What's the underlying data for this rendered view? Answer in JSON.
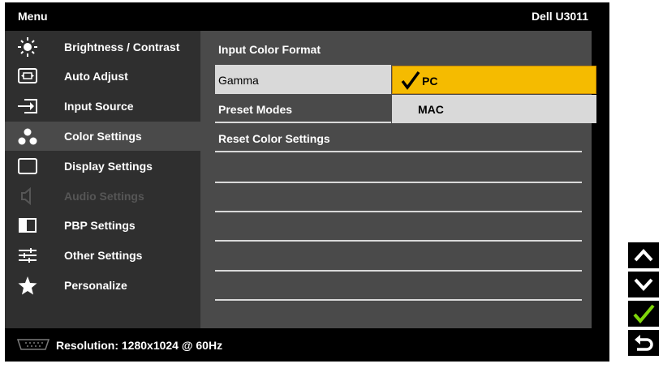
{
  "header": {
    "menu_title": "Menu",
    "model": "Dell U3011"
  },
  "sidebar": {
    "items": [
      {
        "label": "Brightness / Contrast",
        "icon": "brightness-icon",
        "state": "normal"
      },
      {
        "label": "Auto Adjust",
        "icon": "auto-adjust-icon",
        "state": "normal"
      },
      {
        "label": "Input Source",
        "icon": "input-source-icon",
        "state": "normal"
      },
      {
        "label": "Color Settings",
        "icon": "color-settings-icon",
        "state": "active"
      },
      {
        "label": "Display Settings",
        "icon": "display-settings-icon",
        "state": "normal"
      },
      {
        "label": "Audio Settings",
        "icon": "speaker-icon",
        "state": "disabled"
      },
      {
        "label": "PBP Settings",
        "icon": "pbp-icon",
        "state": "normal"
      },
      {
        "label": "Other Settings",
        "icon": "sliders-icon",
        "state": "normal"
      },
      {
        "label": "Personalize",
        "icon": "star-icon",
        "state": "normal"
      }
    ]
  },
  "content": {
    "rows": [
      {
        "label": "Input Color Format"
      },
      {
        "label": "Gamma"
      },
      {
        "label": "Preset Modes"
      },
      {
        "label": "Reset Color Settings"
      }
    ],
    "gamma_options": [
      {
        "label": "PC",
        "selected": true
      },
      {
        "label": "MAC",
        "selected": false
      }
    ]
  },
  "footer": {
    "resolution": "Resolution: 1280x1024 @ 60Hz",
    "icon": "vga-connector-icon"
  },
  "buttons": [
    {
      "icon": "up-arrow-icon"
    },
    {
      "icon": "down-arrow-icon"
    },
    {
      "icon": "check-icon"
    },
    {
      "icon": "back-icon"
    }
  ],
  "colors": {
    "osd_background": "#000000",
    "sidebar": "#2f2f2f",
    "panel": "#4a4a4a",
    "highlight": "#f5bb00",
    "row_selected": "#d9d9d9",
    "check": "#7fd60a"
  }
}
